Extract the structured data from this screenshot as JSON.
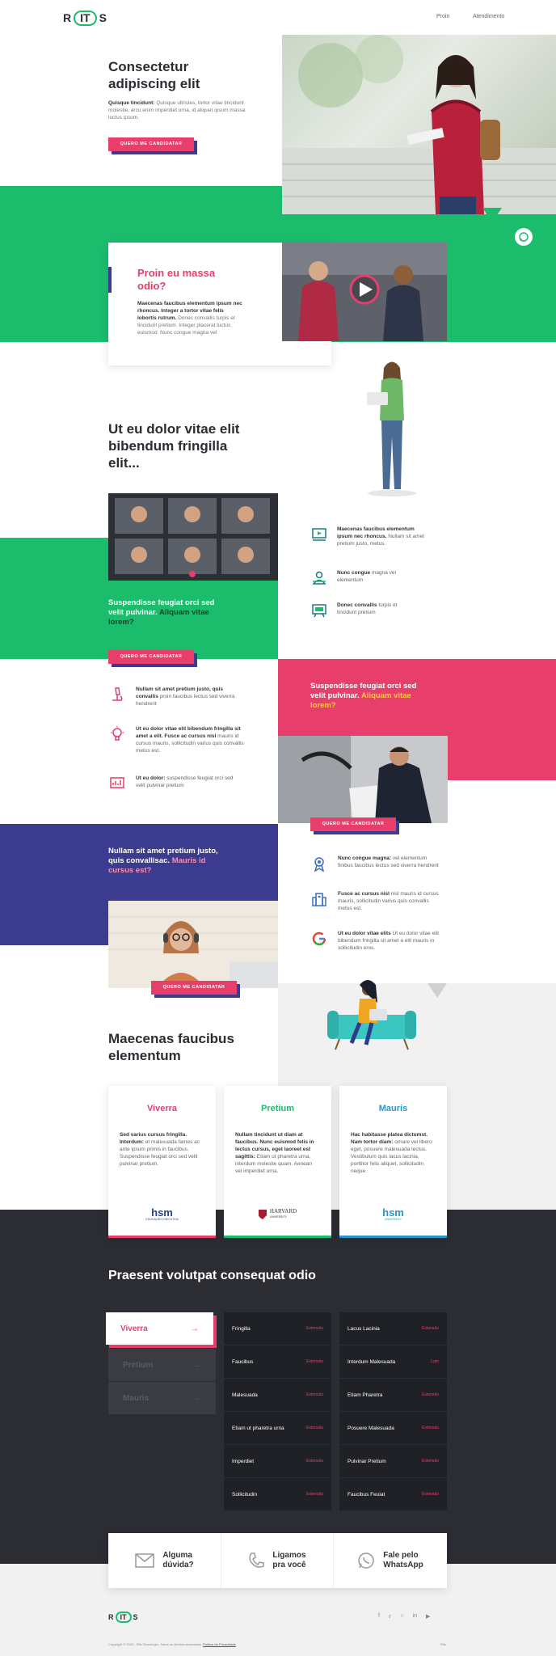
{
  "header": {
    "logo_left": "R",
    "logo_mid": "IT",
    "logo_right": "S",
    "nav": [
      "Proin",
      "Atendimento"
    ]
  },
  "hero": {
    "title_l1": "Consectetur",
    "title_l2": "adipiscing elit",
    "text_bold": "Quisque tincidunt:",
    "text_rest": "Quisque ultricies, tortor vitae tincidunt molestie, arcu enim imperdiet urna, id aliquet ipsum massa luctus ipsum.",
    "button": "Quero me candidatar"
  },
  "video": {
    "title_l1": "Proin eu massa",
    "title_l2": "odio?",
    "text_bold": "Maecenas faucibus elementum ipsum nec rhoncus. Integer a tortor vitae felis lobortis rutrum.",
    "text_rest": "Donec convallis turpis et tincidunt pretium. Integer placerat luctus euismod. Nunc congue magna vel"
  },
  "sec3": {
    "title_l1": "Ut eu dolor vitae elit",
    "title_l2": "bibendum fringilla",
    "title_l3": "elit..."
  },
  "green_block": {
    "title_white": "Suspendisse feugiat orci sed velit pulvinar.",
    "title_dark": "Aliquam vitae lorem?",
    "button": "Quero me candidatar"
  },
  "features_right": [
    {
      "icon": "video-call-icon",
      "bold": "Maecenas faucibus elementum ipsum nec rhoncus.",
      "rest": "Nullam sit amet pretium justo, metus."
    },
    {
      "icon": "presenter-icon",
      "bold": "Nunc congue",
      "rest": "magna vel elementum"
    },
    {
      "icon": "whiteboard-icon",
      "bold": "Donec convallis",
      "rest": "turpis et tincidunt pretium"
    }
  ],
  "features_left": [
    {
      "icon": "microscope-icon",
      "bold": "Nullam sit amet pretium justo, quis convallis",
      "rest": "proin faucibus lectus sed viverra hendrerit"
    },
    {
      "icon": "lightbulb-icon",
      "bold": "Ut eu dolor vitae elit bibendum fringilla sit amet a elit. Fusce ac cursus nisl",
      "rest": "mauris id cursus mauris, sollicitudin varius quis convallis metus est."
    },
    {
      "icon": "chart-board-icon",
      "bold": "Ut eu dolor:",
      "rest": "suspendisse feugiat orci sed velit pulvinar pretium"
    }
  ],
  "pink_block": {
    "title_white": "Suspendisse feugiat orci sed velit pulvinar.",
    "title_yellow": "Aliquam vitae lorem?",
    "button": "Quero me candidatar"
  },
  "features_right2": [
    {
      "icon": "award-icon",
      "bold": "Nunc congue magna:",
      "rest": "vel elementum finibus faucibus lectus sed viverra hendrerit"
    },
    {
      "icon": "building-icon",
      "bold": "Fusce ac cursus nisl",
      "rest": "nisl mauris id cursus mauris, sollicitudin varius quis convallis metus est."
    },
    {
      "icon": "google-icon",
      "bold": "Ut eu dolor vitae elits",
      "rest": "Ut eu dolor vitae elit bibendum fringilla sit amet a elit mauris in sollicitudin eros."
    }
  ],
  "blue_block": {
    "title_white": "Nullam sit amet pretium justo, quis convallisac.",
    "title_pink": "Mauris id cursus est?",
    "button": "Quero me candidatar"
  },
  "partners": {
    "title_l1": "Maecenas faucibus",
    "title_l2": "elementum",
    "cards": [
      {
        "name": "Viverra",
        "color": "#e83e6c",
        "bold": "Sed varius cursus fringilla. Interdum:",
        "rest": "et malesuada fames ac ante ipsum primis in faucibus. Suspendisse feugiat orci sed velit pulvinar pretium.",
        "logo": "hsm",
        "logo_sub": "EDUCAÇÃO EXECUTIVA"
      },
      {
        "name": "Pretium",
        "color": "#1bbd6d",
        "bold": "Nullam tincidunt ut diam at faucibus. Nunc euismod felis in lectus cursus, eget laoreet est sagittis:",
        "rest": "Etiam ut pharetra urna, interdum molestie quam. Aenean vel imperdiet urna.",
        "logo": "HARVARD",
        "logo_sub": "UNIVERSITY"
      },
      {
        "name": "Mauris",
        "color": "#2a93c9",
        "bold": "Hac habitasse platea dictumst. Nam tortor diam:",
        "rest": "ornare vel libero eget, posuere malesuada lectus. Vestibulum quis lacus lacinia, porttitor felis aliquet, sollicitudin neque.",
        "logo": "hsm",
        "logo_sub": "UNIVERSITY"
      }
    ]
  },
  "courses": {
    "title": "Praesent volutpat consequat odio",
    "tabs": [
      "Viverra",
      "Pretium",
      "Mauris"
    ],
    "tag": "Extensão",
    "tag_alt": "Lato",
    "col1": [
      "Fringilla",
      "Faucibus",
      "Malesuada",
      "Etiam ut pharetra urna",
      "Imperdiet",
      "Sollicitudin"
    ],
    "col2": [
      "Lacus Lacinia",
      "Interdum Malesuada",
      "Etiam Pharetra",
      "Posuere Malesuada",
      "Pulvinar Pretium",
      "Faucibus Feuiat"
    ]
  },
  "contact": [
    {
      "icon": "mail-icon",
      "l1": "Alguma",
      "l2": "dúvida?"
    },
    {
      "icon": "phone-icon",
      "l1": "Ligamos",
      "l2": "pra você"
    },
    {
      "icon": "whatsapp-icon",
      "l1": "Fale pelo",
      "l2": "WhatsApp"
    }
  ],
  "footer": {
    "copyright": "Copyright © 2020 - Rits Tecnologia. Todos os direitos reservados.",
    "privacy": "Política de Privacidade",
    "right": "Rits"
  },
  "colors": {
    "green": "#1bbd6d",
    "pink": "#e83e6c",
    "navy": "#3b3b8f",
    "dark": "#2b2d33"
  }
}
